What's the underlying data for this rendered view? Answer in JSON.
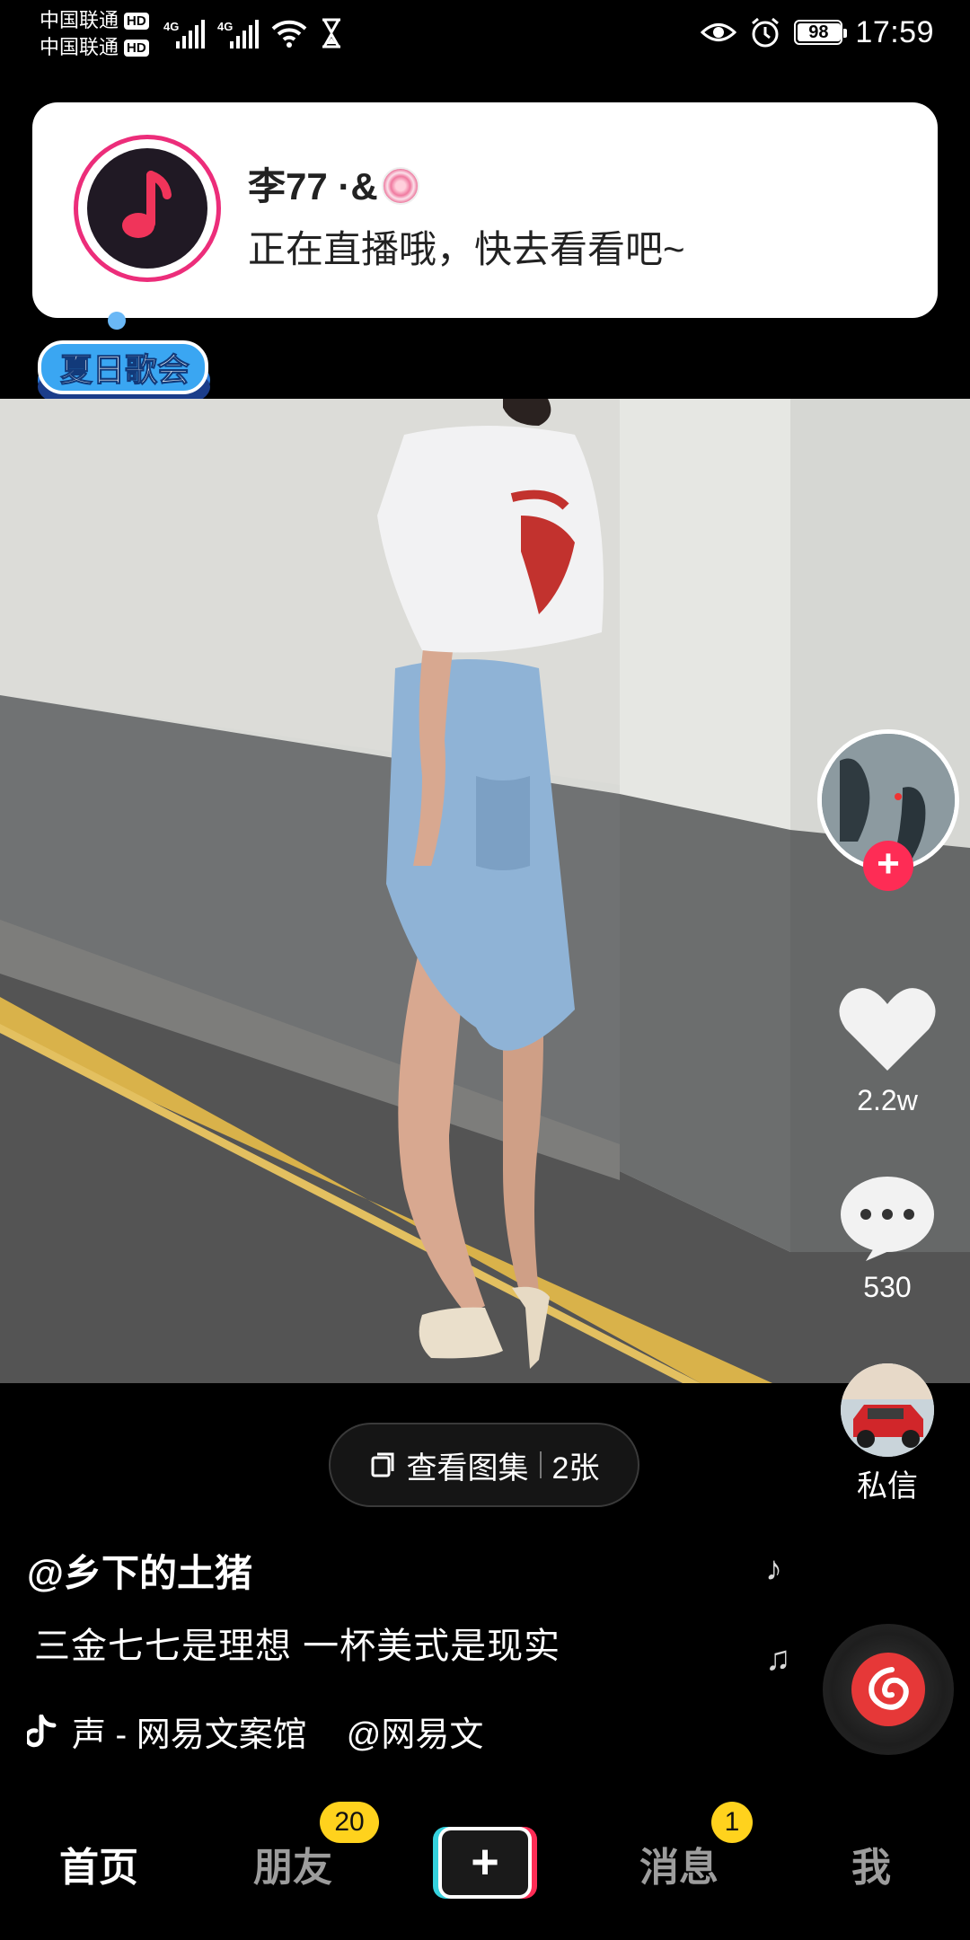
{
  "status_bar": {
    "carrier_1": "中国联通",
    "carrier_2": "中国联通",
    "hd_badge": "HD",
    "network_1": "4G",
    "network_2": "4G",
    "battery": "98",
    "time": "17:59",
    "icons": [
      "eye-icon",
      "alarm-icon",
      "wifi-icon",
      "hourglass-icon"
    ]
  },
  "notification": {
    "name": "李77 ·&",
    "message": "正在直播哦，快去看看吧~"
  },
  "event_badge": {
    "label": "夏日歌会"
  },
  "right_rail": {
    "likes": "2.2w",
    "comments": "530",
    "dm_label": "私信"
  },
  "gallery": {
    "label": "查看图集",
    "count": "2张"
  },
  "post": {
    "author": "@乡下的土猪",
    "caption": "三金七七是理想 一杯美式是现实",
    "music": "声 - 网易文案馆",
    "music_author": "@网易文"
  },
  "bottom_nav": {
    "home": "首页",
    "friends": "朋友",
    "friends_badge": "20",
    "create": "+",
    "messages": "消息",
    "messages_badge": "1",
    "me": "我"
  },
  "colors": {
    "accent_red": "#fe2c55",
    "badge_yellow": "#ffd21d",
    "avatar_ring": "#ec2d7a"
  }
}
